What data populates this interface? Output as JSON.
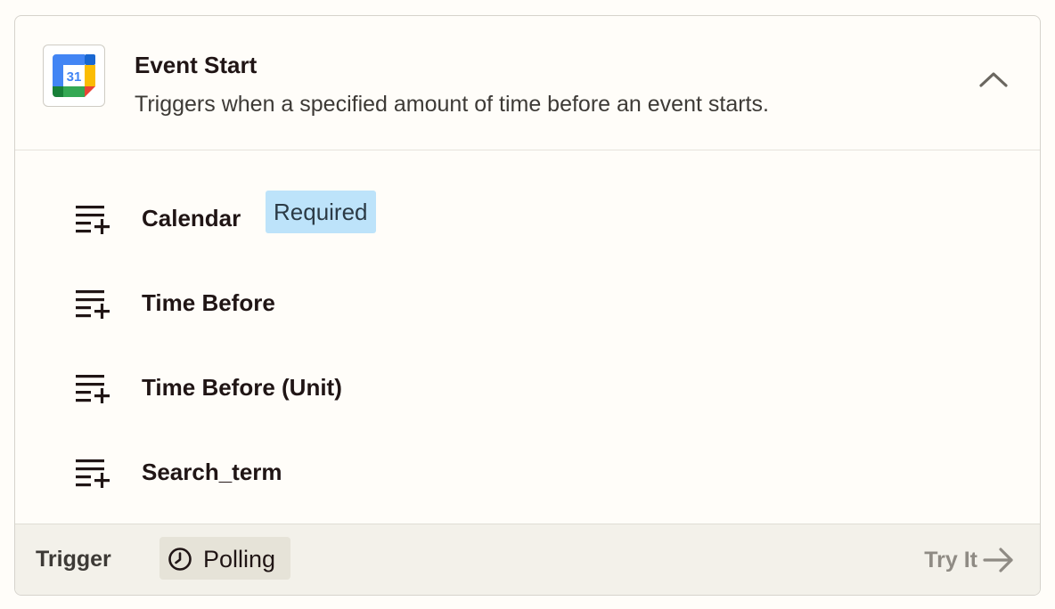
{
  "header": {
    "icon": "google-calendar-icon",
    "icon_text": "31",
    "title": "Event Start",
    "subtitle": "Triggers when a specified amount of time before an event starts.",
    "collapse_icon": "chevron-up-icon"
  },
  "fields": [
    {
      "label": "Calendar",
      "badge": "Required",
      "icon": "add-list-icon"
    },
    {
      "label": "Time Before",
      "icon": "add-list-icon"
    },
    {
      "label": "Time Before (Unit)",
      "icon": "add-list-icon"
    },
    {
      "label": "Search_term",
      "icon": "add-list-icon"
    }
  ],
  "footer": {
    "type_label": "Trigger",
    "mode_label": "Polling",
    "mode_icon": "clock-icon",
    "action_label": "Try It",
    "action_icon": "arrow-right-icon"
  },
  "colors": {
    "badge_background": "#bde3fa",
    "footer_background": "#f3f1ea",
    "page_background": "#fffdf9"
  }
}
